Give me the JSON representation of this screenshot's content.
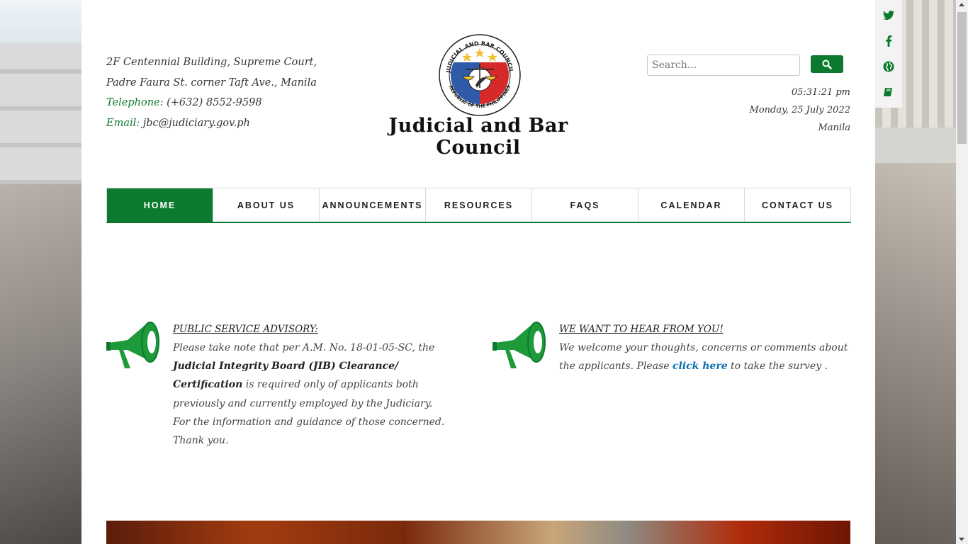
{
  "header": {
    "address_line1": "2F Centennial Building, Supreme Court,",
    "address_line2": "Padre Faura St. corner Taft Ave., Manila",
    "telephone_label": "Telephone:",
    "telephone_value": "(+632) 8552-9598",
    "email_label": "Email:",
    "email_value": "jbc@judiciary.gov.ph",
    "site_title": "Judicial and Bar Council",
    "logo_ring_top": "JUDICIAL AND BAR COUNCIL",
    "logo_ring_bottom": "REPUBLIC OF THE PHILIPPINES"
  },
  "search": {
    "placeholder": "Search...",
    "button_icon": "search-icon"
  },
  "clock": {
    "time": "05:31:21 pm",
    "date": "Monday, 25 July 2022",
    "city": "Manila"
  },
  "social": [
    {
      "icon": "twitter-icon"
    },
    {
      "icon": "facebook-icon"
    },
    {
      "icon": "globe-icon"
    },
    {
      "icon": "book-icon"
    }
  ],
  "nav": {
    "items": [
      {
        "label": "HOME",
        "active": true
      },
      {
        "label": "ABOUT US"
      },
      {
        "label": "ANNOUNCEMENTS"
      },
      {
        "label": "RESOURCES"
      },
      {
        "label": "FAQS"
      },
      {
        "label": "CALENDAR"
      },
      {
        "label": "CONTACT US"
      }
    ]
  },
  "advisory1": {
    "heading": "PUBLIC SERVICE ADVISORY:",
    "text1": "Please take note that per A.M. No. 18-01-05-SC, the ",
    "strong": "Judicial Integrity Board (JIB) Clearance/ Certification",
    "text2": " is required only of applicants both previously and currently employed by the Judiciary.",
    "text3": "For the information and guidance of those concerned. Thank you."
  },
  "advisory2": {
    "heading": "WE WANT TO HEAR FROM YOU!",
    "text1": "We welcome your thoughts, concerns or comments about the applicants. Please ",
    "link": "click here",
    "text2": " to take the survey ."
  },
  "colors": {
    "brand_green": "#0b7a2e",
    "link_blue": "#0b6fb0"
  }
}
